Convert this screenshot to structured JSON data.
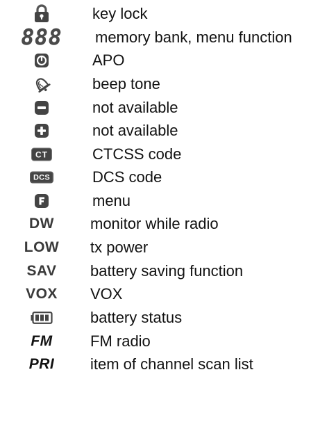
{
  "legend": {
    "items": [
      {
        "icon": "padlock-icon",
        "label": "key lock"
      },
      {
        "icon": "segment-display-icon",
        "icon_text": "888",
        "label": "memory bank, menu function"
      },
      {
        "icon": "power-timer-icon",
        "label": "APO"
      },
      {
        "icon": "bell-icon",
        "label": "beep tone"
      },
      {
        "icon": "minus-icon",
        "label": "not available"
      },
      {
        "icon": "plus-icon",
        "label": "not available"
      },
      {
        "icon": "ct-badge-icon",
        "icon_text": "CT",
        "label": "CTCSS code"
      },
      {
        "icon": "dcs-badge-icon",
        "icon_text": "DCS",
        "label": "DCS code"
      },
      {
        "icon": "f-key-icon",
        "label": "menu"
      },
      {
        "icon": "dw-indicator",
        "icon_text": "DW",
        "label": "monitor while radio"
      },
      {
        "icon": "low-indicator",
        "icon_text": "LOW",
        "label": "tx power"
      },
      {
        "icon": "sav-indicator",
        "icon_text": "SAV",
        "label": "battery saving function"
      },
      {
        "icon": "vox-indicator",
        "icon_text": "VOX",
        "label": "VOX"
      },
      {
        "icon": "battery-icon",
        "label": "battery status"
      },
      {
        "icon": "fm-indicator",
        "icon_text": "FM",
        "label": "FM radio"
      },
      {
        "icon": "pri-indicator",
        "icon_text": "PRI",
        "label": "item of channel scan list"
      }
    ]
  },
  "colors": {
    "text": "#111111",
    "icon_dark": "#444444",
    "icon_text_gray": "#3a3a3a",
    "background": "#ffffff"
  }
}
